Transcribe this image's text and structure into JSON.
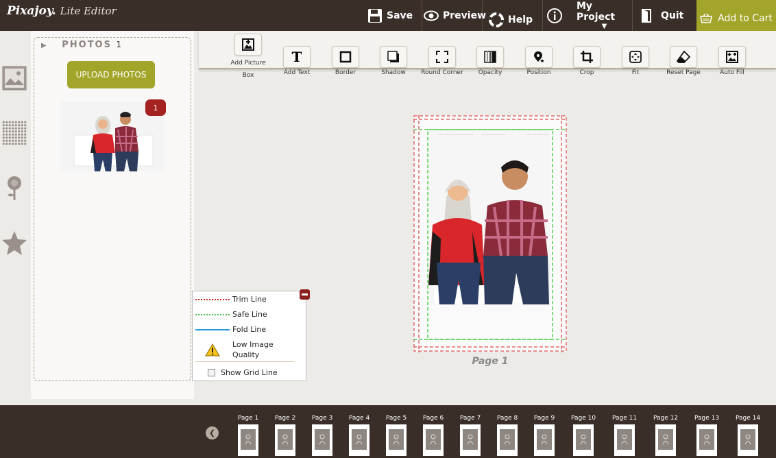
{
  "header": {
    "logo_brand": "Pixajoy.",
    "logo_sub": "Lite Editor",
    "save_label": "Save",
    "preview_label": "Preview",
    "help_label": "Help",
    "myproject_label": "My Project",
    "quit_label": "Quit",
    "cart_label": "Add to Cart"
  },
  "toolbar": {
    "tools": [
      {
        "label": "Add Picture Box",
        "icon": "add-picture-icon"
      },
      {
        "label": "Add Text",
        "icon": "text-icon"
      },
      {
        "label": "Border",
        "icon": "border-icon"
      },
      {
        "label": "Shadow",
        "icon": "shadow-icon"
      },
      {
        "label": "Round Corner",
        "icon": "round-corner-icon"
      },
      {
        "label": "Opacity",
        "icon": "opacity-icon"
      },
      {
        "label": "Position",
        "icon": "position-icon"
      },
      {
        "label": "Crop",
        "icon": "crop-icon"
      },
      {
        "label": "Fit",
        "icon": "fit-icon"
      },
      {
        "label": "Reset Page",
        "icon": "eraser-icon"
      },
      {
        "label": "Auto Fill",
        "icon": "auto-fill-icon"
      }
    ]
  },
  "sidebar": {
    "icons": [
      "photos-icon",
      "patterns-icon",
      "flower-icon",
      "star-icon"
    ]
  },
  "photos_panel": {
    "title": "PHOTOS",
    "count": "1",
    "upload_label": "UPLOAD PHOTOS",
    "badge": "1"
  },
  "legend": {
    "trim_label": "Trim Line",
    "safe_label": "Safe Line",
    "fold_label": "Fold Line",
    "lowq_label_1": "Low Image",
    "lowq_label_2": "Quality",
    "grid_label": "Show Grid Line",
    "colors": {
      "trim": "#c8281e",
      "safe": "#3fc13f",
      "fold": "#2a9ad8"
    }
  },
  "canvas": {
    "page_label": "Page 1"
  },
  "pages": {
    "items": [
      "Page 1",
      "Page 2",
      "Page 3",
      "Page 4",
      "Page 5",
      "Page 6",
      "Page 7",
      "Page 8",
      "Page 9",
      "Page 10",
      "Page 11",
      "Page 12",
      "Page 13",
      "Page 14"
    ]
  },
  "colors": {
    "header_bg": "#3a2f28",
    "accent": "#a3a52a",
    "badge": "#a52222"
  }
}
